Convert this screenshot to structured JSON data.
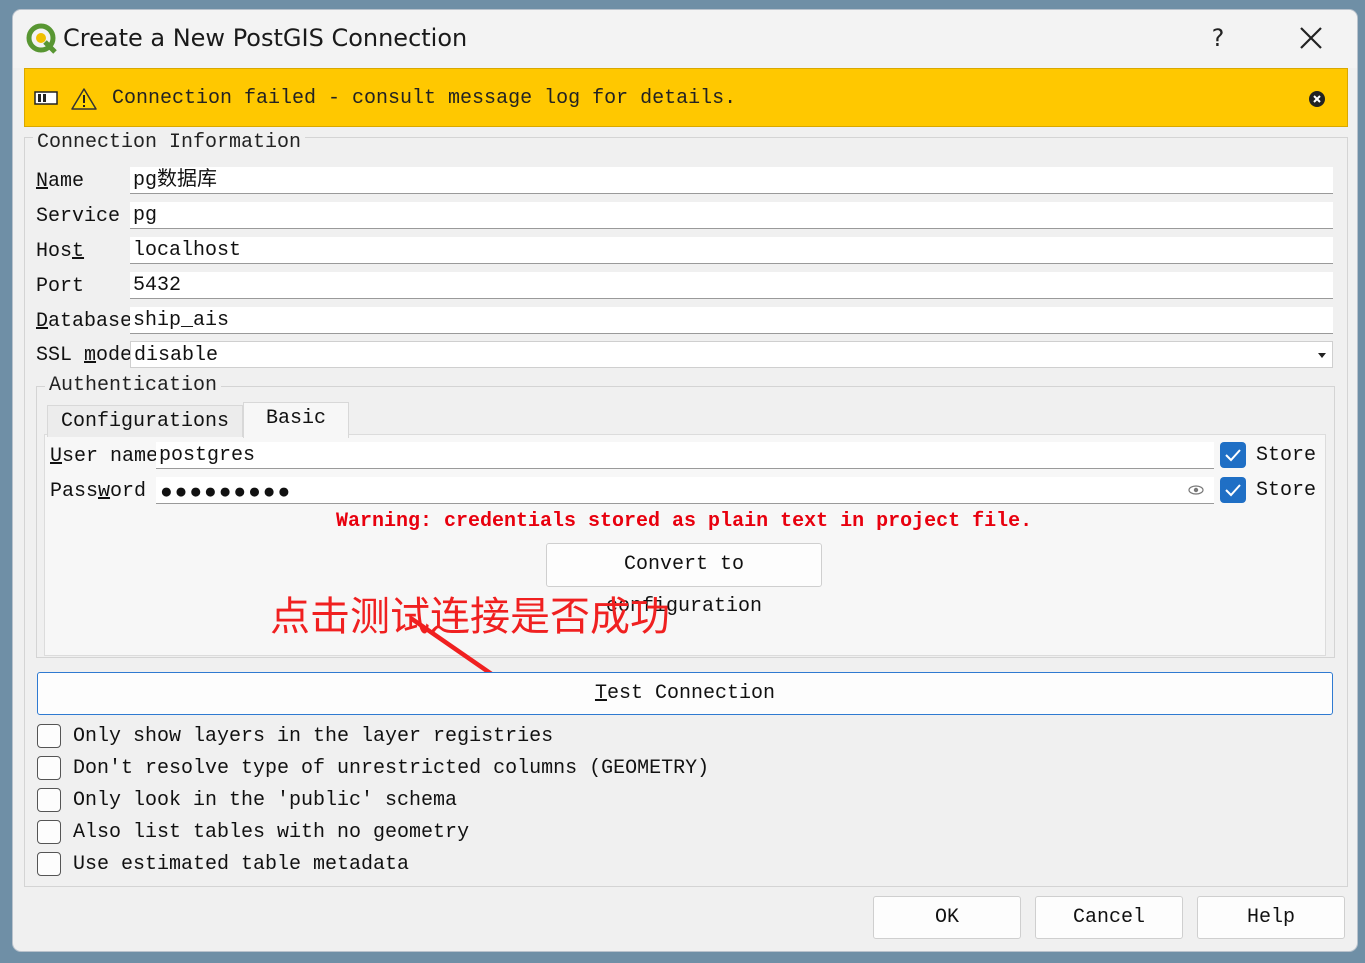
{
  "window": {
    "title": "Create a New PostGIS Connection",
    "help_glyph": "?"
  },
  "banner": {
    "message": "Connection failed - consult message log for details.",
    "color": "#ffc800"
  },
  "connection": {
    "group_title": "Connection Information",
    "fields": {
      "name": {
        "label": "Name",
        "value": "pg数据库"
      },
      "service": {
        "label": "Service",
        "value": "pg"
      },
      "host": {
        "label": "Host",
        "value": "localhost"
      },
      "port": {
        "label": "Port",
        "value": "5432"
      },
      "database": {
        "label": "Database",
        "value": "ship_ais"
      },
      "ssl_mode": {
        "label": "SSL mode",
        "value": "disable"
      }
    }
  },
  "authentication": {
    "group_title": "Authentication",
    "tabs": [
      "Configurations",
      "Basic"
    ],
    "active_tab": "Basic",
    "user_name": {
      "label": "User name",
      "value": "postgres",
      "store_label": "Store",
      "store_checked": true
    },
    "password": {
      "label": "Password",
      "masked_value": "●●●●●●●●●",
      "store_label": "Store",
      "store_checked": true
    },
    "warning": "Warning: credentials stored as plain text in project file.",
    "convert_button": "Convert to configuration"
  },
  "annotation": {
    "text": "点击测试连接是否成功",
    "color": "#f02020"
  },
  "test_button": "Test Connection",
  "options": [
    {
      "label": "Only show layers in the layer registries",
      "checked": false
    },
    {
      "label": "Don't resolve type of unrestricted columns (GEOMETRY)",
      "checked": false
    },
    {
      "label": "Only look in the 'public' schema",
      "checked": false
    },
    {
      "label": "Also list tables with no geometry",
      "checked": false
    },
    {
      "label": "Use estimated table metadata",
      "checked": false
    }
  ],
  "buttons": {
    "ok": "OK",
    "cancel": "Cancel",
    "help": "Help"
  },
  "colors": {
    "accent": "#1f6fc5",
    "warning_text": "#e8000e"
  }
}
